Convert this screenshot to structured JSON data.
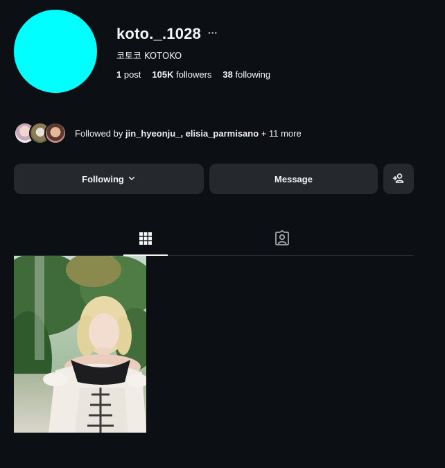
{
  "profile": {
    "username": "koto._.1028",
    "more_glyph": "···",
    "display_name": "코토코 KOTOKO",
    "avatar_color": "#00ffff"
  },
  "stats": {
    "posts_count": "1",
    "posts_label": " post",
    "followers_count": "105K",
    "followers_label": " followers",
    "following_count": "38",
    "following_label": " following"
  },
  "followed_by": {
    "prefix": "Followed by ",
    "names": "jin_hyeonju_, elisia_parmisano",
    "suffix": " + 11 more"
  },
  "actions": {
    "following_label": "Following",
    "message_label": "Message",
    "add_user_icon": "add-person-icon"
  },
  "tabs": [
    {
      "icon": "grid-icon",
      "active": true
    },
    {
      "icon": "tagged-person-icon",
      "active": false
    }
  ],
  "accent_colors": {
    "background": "#0c0f14",
    "button": "#25292e",
    "text": "#f5f5f5"
  }
}
